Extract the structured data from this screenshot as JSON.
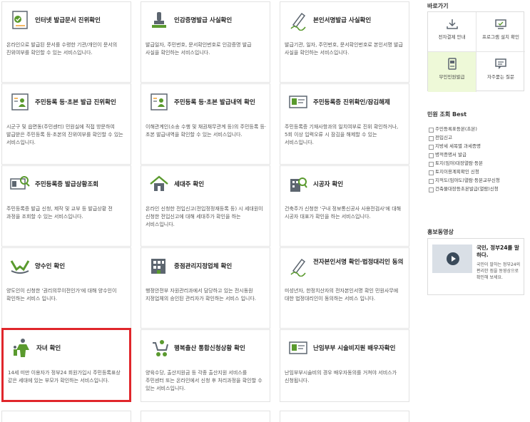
{
  "cards": [
    {
      "title": "인터넷 발급문서 진위확인",
      "desc": "온라인으로 발급된 문서를 수령한 기관/개인이 문서의 진위여부를 확인할 수 있는 서비스입니다."
    },
    {
      "title": "인감증명발급 사실확인",
      "desc": "발급일자, 주민번호, 문서확인번호로 인감증명 발급 사실을 확인하는 서비스입니다."
    },
    {
      "title": "본인서명발급 사실확인",
      "desc": "발급기관, 일자, 주민번호, 문서확인번호로 본인서명 발급 사실을 확인하는 서비스입니다."
    },
    {
      "title": "주민등록 등·초본 발급 진위확인",
      "desc": "시군구 및 읍면동(주민센터) 민원실에 직접 방문하여 발급받은 주민등록 등·초본의 진위여부를 확인할 수 있는 서비스입니다."
    },
    {
      "title": "주민등록 등·초본 발급내역 확인",
      "desc": "이해관계인(소송 수행 및 채권채무관계 등)의 주민등록 등·초본 발급내역을 확인할 수 있는 서비스입니다."
    },
    {
      "title": "주민등록증 진위확인/잠김해제",
      "desc": "주민등록증 기재사항과의 일치여부로 진위 확인하거나, 5회 이상 입력오류 시 잠김을 해제할 수 있는 서비스입니다."
    },
    {
      "title": "주민등록증 발급상황조회",
      "desc": "주민등록증 발급 신청, 제작 및 교부 등 발급상황 전 과정을 조회할 수 있는 서비스입니다."
    },
    {
      "title": "세대주 확인",
      "desc": "온라인 신청한 전입신고(전입정정재등록 등) 시 세대원이 신청한 전입신고에 대해 세대주가 확인을 하는 서비스입니다."
    },
    {
      "title": "시공자 확인",
      "desc": "건축주가 신청한 '구내 정보통신공사 사용전검사'에 대해 시공자 대표가 확인을 하는 서비스입니다."
    },
    {
      "title": "양수인 확인",
      "desc": "양도인이 신청한 '권리의무이전인가'에 대해 양수인이 확인하는 서비스 입니다."
    },
    {
      "title": "중점관리지정업체 확인",
      "desc": "행정안전부 자원관리과에서 담당하고 있는 전시동원 지정업체의 승인된 관리자가 확인하는 서비스 입니다."
    },
    {
      "title": "전자본인서명 확인·법정대리인 동의",
      "desc": "미성년자, 한정치산자의 전자본인서명 확인 민원사무에 대한 법정대리인이 동의하는 서비스 입니다."
    },
    {
      "title": "자녀 확인",
      "desc": "14세 미만 이용자가 정부24 회원가입시 주민등록표상 같은 세대에 있는 부모가 확인하는 서비스입니다."
    },
    {
      "title": "행복출산 통합신청상황 확인",
      "desc": "양육수당, 출산지원금 등 각종 출산지원 서비스를 주민센터 또는 온라인에서 신청 후 처리과정을 확인할 수 있는 서비스입니다."
    },
    {
      "title": "난임부부 시술비지원 배우자확인",
      "desc": "난임부부시술비의 경우 배우자동의를 거쳐야 서비스가 신청됩니다."
    }
  ],
  "sidebar": {
    "shortcuts_title": "바로가기",
    "shortcuts": [
      {
        "label": "전자결제 안내",
        "icon": "payment-icon",
        "active": false
      },
      {
        "label": "프로그램 설치 확인",
        "icon": "monitor-icon",
        "active": false
      },
      {
        "label": "무인민원발급",
        "icon": "kiosk-icon",
        "active": true
      },
      {
        "label": "자주묻는 질문",
        "icon": "faq-icon",
        "active": false
      }
    ],
    "best_title": "민원 조회 Best",
    "best_items": [
      "주민등록표등본(초본)",
      "전입신고",
      "지방세 세목별 과세증명",
      "병적증명서 발급",
      "토지(임야)대장열람·등본",
      "토지이용계획확인 신청",
      "지적도(임야도)열람·등본교부신청",
      "건축물대장등초본발급(열람)신청"
    ],
    "promo_title": "홍보동영상",
    "promo_video_title": "국민, 정부24를 말하다.",
    "promo_video_desc": "국민이 말하는 정부24의 편리한 점을 동영상으로 확인해 보세요."
  },
  "colors": {
    "accent_green": "#5a9a2e",
    "icon_gray": "#5d6670",
    "highlight_red": "#e0262b",
    "shortcut_active_bg": "#eef9d8"
  }
}
